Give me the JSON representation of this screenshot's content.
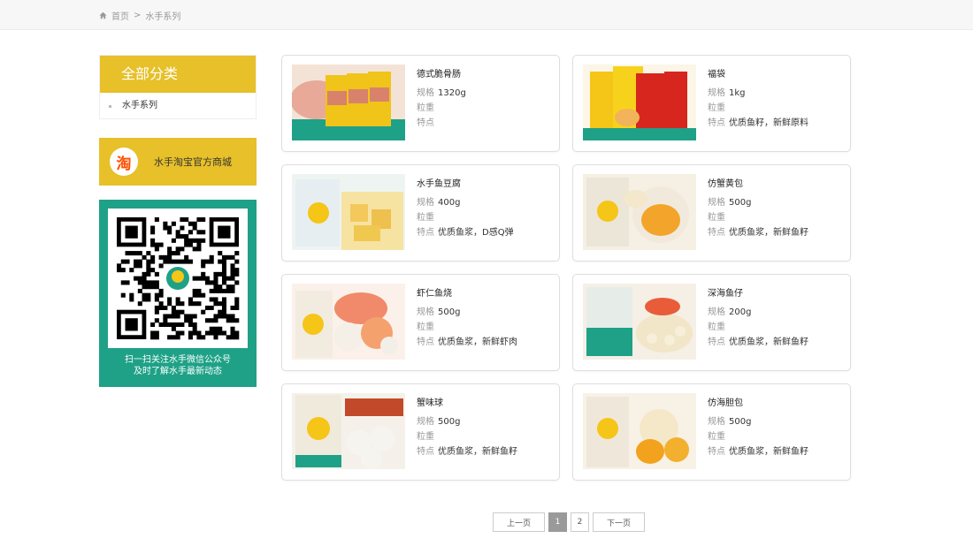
{
  "breadcrumb": {
    "home": "首页",
    "separator": ">",
    "current": "水手系列"
  },
  "sidebar": {
    "category_title": "全部分类",
    "categories": [
      "水手系列"
    ],
    "taobao_logo_char": "淘",
    "taobao_label": "水手淘宝官方商城",
    "qr_caption_line1": "扫一扫关注水手微信公众号",
    "qr_caption_line2": "及时了解水手最新动态"
  },
  "labels": {
    "spec": "规格",
    "weight": "粒重",
    "feature": "特点"
  },
  "products": [
    {
      "name": "德式脆骨肠",
      "spec": "1320g",
      "weight": "",
      "feature": "",
      "image": "sausage-packs"
    },
    {
      "name": "福袋",
      "spec": "1kg",
      "weight": "",
      "feature": "优质鱼籽，新鲜原料",
      "image": "fudai-packs"
    },
    {
      "name": "水手鱼豆腐",
      "spec": "400g",
      "weight": "",
      "feature": "优质鱼浆，D感Q弹",
      "image": "fish-tofu"
    },
    {
      "name": "仿蟹黄包",
      "spec": "500g",
      "weight": "",
      "feature": "优质鱼浆，新鲜鱼籽",
      "image": "crab-bun"
    },
    {
      "name": "虾仁鱼烧",
      "spec": "500g",
      "weight": "",
      "feature": "优质鱼浆，新鲜虾肉",
      "image": "shrimp-fish"
    },
    {
      "name": "深海鱼仔",
      "spec": "200g",
      "weight": "",
      "feature": "优质鱼浆，新鲜鱼籽",
      "image": "deepsea-fish"
    },
    {
      "name": "蟹味球",
      "spec": "500g",
      "weight": "",
      "feature": "优质鱼浆，新鲜鱼籽",
      "image": "crab-ball"
    },
    {
      "name": "仿海胆包",
      "spec": "500g",
      "weight": "",
      "feature": "优质鱼浆，新鲜鱼籽",
      "image": "urchin-bun"
    }
  ],
  "pagination": {
    "prev": "上一页",
    "pages": [
      "1",
      "2"
    ],
    "current": "1",
    "next": "下一页"
  },
  "colors": {
    "brand_yellow": "#e7c02a",
    "qr_green": "#1ea187",
    "taobao_orange": "#ff5000"
  }
}
